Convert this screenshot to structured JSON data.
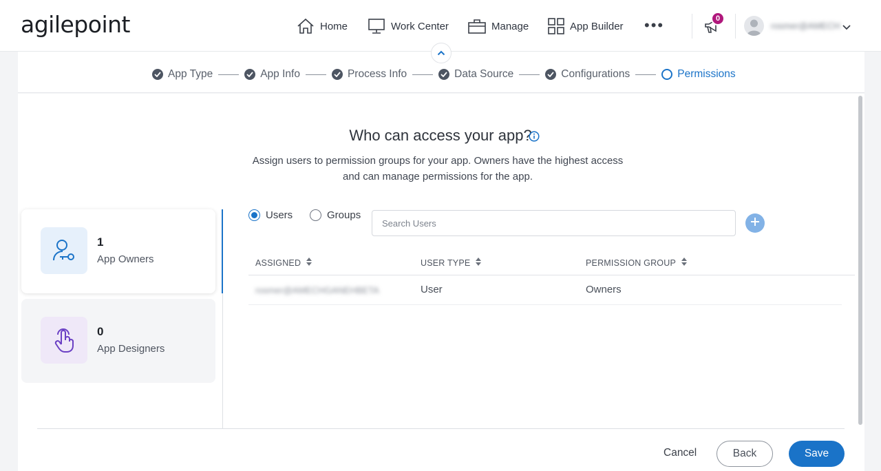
{
  "brand": {
    "logo_text": "agilepoint"
  },
  "nav": {
    "items": [
      {
        "label": "Home",
        "icon": "home-icon"
      },
      {
        "label": "Work Center",
        "icon": "monitor-icon"
      },
      {
        "label": "Manage",
        "icon": "briefcase-icon"
      },
      {
        "label": "App Builder",
        "icon": "grid-icon"
      }
    ],
    "more_label": "•••",
    "notifications_count": "0",
    "user_name": "rosmer@AMECH"
  },
  "stepper": {
    "steps": [
      {
        "label": "App Type",
        "state": "complete"
      },
      {
        "label": "App Info",
        "state": "complete"
      },
      {
        "label": "Process Info",
        "state": "complete"
      },
      {
        "label": "Data Source",
        "state": "complete"
      },
      {
        "label": "Configurations",
        "state": "complete"
      },
      {
        "label": "Permissions",
        "state": "active"
      }
    ]
  },
  "main": {
    "title": "Who can access your app?",
    "subtitle": "Assign users to permission groups for your app. Owners have the highest access and can manage permissions for the app."
  },
  "groups": [
    {
      "count": "1",
      "name": "App Owners",
      "selected": true
    },
    {
      "count": "0",
      "name": "App Designers",
      "selected": false
    }
  ],
  "filter": {
    "users_label": "Users",
    "groups_label": "Groups",
    "selected": "Users",
    "search_placeholder": "Search Users",
    "search_value": ""
  },
  "table": {
    "columns": [
      "ASSIGNED",
      "USER TYPE",
      "PERMISSION GROUP"
    ],
    "rows": [
      {
        "assigned": "rosmer@AMECHGANEHBETA",
        "user_type": "User",
        "permission_group": "Owners"
      }
    ]
  },
  "footer": {
    "cancel_label": "Cancel",
    "back_label": "Back",
    "save_label": "Save"
  },
  "colors": {
    "accent": "#1a73c8",
    "badge": "#b0187c",
    "owners_icon_bg": "#e6f0fb",
    "designers_icon_bg": "#efe8f8"
  }
}
